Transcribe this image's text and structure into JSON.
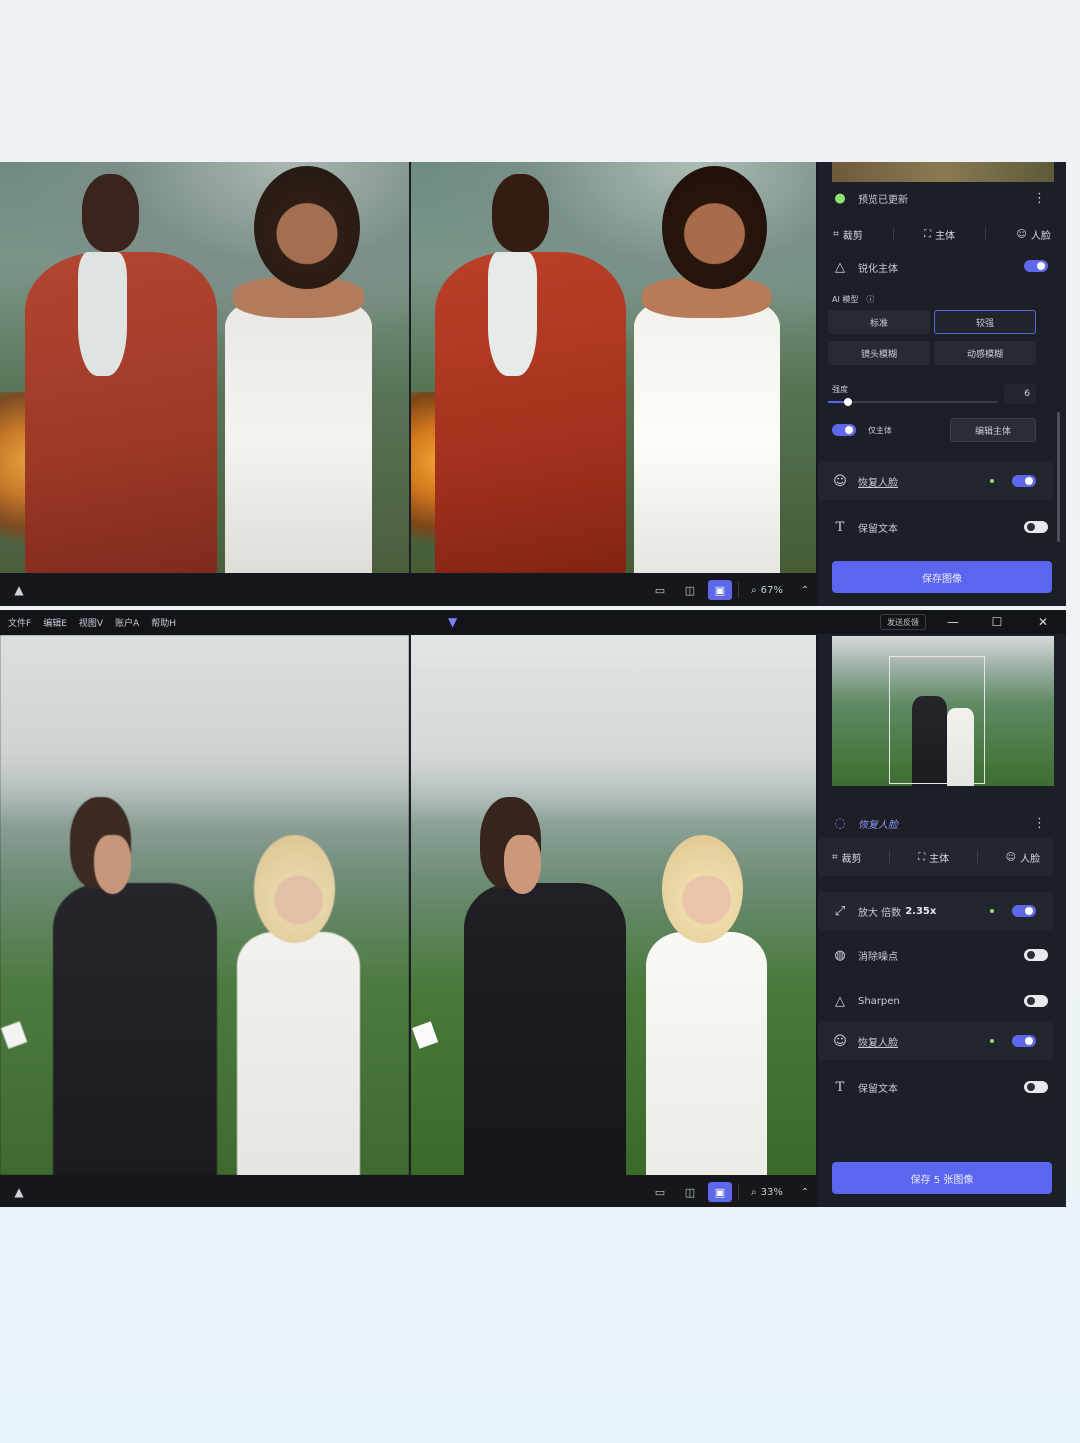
{
  "window1": {
    "status_text": "预览已更新",
    "tabs": [
      "裁剪",
      "主体",
      "人脸"
    ],
    "partial_row_label": "锐化主体",
    "ai_model_label": "AI 模型",
    "model_options": [
      "标准",
      "较强",
      "镜头模糊",
      "动感模糊"
    ],
    "selected_model": "较强",
    "strength_label": "强度",
    "strength_value": "6",
    "strength_level": 0.12,
    "subject_toggle_label": "仅主体",
    "edit_subject_button": "编辑主体",
    "face_recovery_label": "恢复人脸",
    "preserve_text_label": "保留文本",
    "save_button": "保存图像",
    "zoom": "67%"
  },
  "window2": {
    "menu": [
      "文件F",
      "编辑E",
      "视图V",
      "账户A",
      "帮助H"
    ],
    "feedback_button": "发送反馈",
    "status_text": "恢复人脸",
    "tabs": [
      "裁剪",
      "主体",
      "人脸"
    ],
    "upscale_label": "放大 倍数",
    "upscale_value": "2.35x",
    "denoise_label": "消除噪点",
    "sharpen_label": "Sharpen",
    "face_recovery_label": "恢复人脸",
    "preserve_text_label": "保留文本",
    "save_button": "保存 5 张图像",
    "zoom": "33%"
  },
  "colors": {
    "accent": "#5b66ef",
    "panel": "#1c1f26",
    "status_ok": "#8fe076"
  }
}
